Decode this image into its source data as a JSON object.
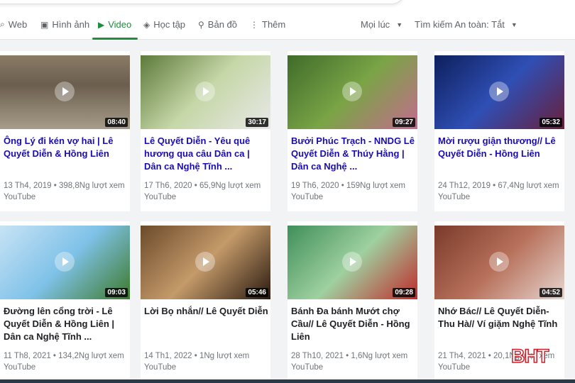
{
  "tabs": [
    {
      "label": "Web",
      "icon": "search-icon"
    },
    {
      "label": "Hình ảnh",
      "icon": "image-icon"
    },
    {
      "label": "Video",
      "icon": "video-icon",
      "active": true
    },
    {
      "label": "Học tập",
      "icon": "school-icon"
    },
    {
      "label": "Bản đồ",
      "icon": "map-pin-icon"
    },
    {
      "label": "Thêm",
      "icon": "more-icon"
    }
  ],
  "filters": {
    "time": "Mọi lúc",
    "safe_search": "Tìm kiếm An toàn: Tắt"
  },
  "videos": [
    {
      "title": "Ông Lý đi kén vợ hai | Lê Quyết Diễn & Hồng Liên",
      "duration": "08:40",
      "meta": "13 Th4, 2019 • 398,8Ng lượt xem",
      "source": "YouTube"
    },
    {
      "title": "Lê Quyết Diễn - Yêu quê hương qua câu Dân ca | Dân ca Nghệ Tĩnh ...",
      "duration": "30:17",
      "meta": "17 Th6, 2020 • 65,9Ng lượt xem",
      "source": "YouTube"
    },
    {
      "title": "Bưởi Phúc Trạch - NNDG Lê Quyết Diễn & Thúy Hằng | Dân ca Nghệ ...",
      "duration": "09:27",
      "meta": "19 Th6, 2020 • 159Ng lượt xem",
      "source": "YouTube"
    },
    {
      "title": "Mời rượu giận thương// Lê Quyết Diễn - Hồng Liên",
      "duration": "05:32",
      "meta": "24 Th12, 2019 • 67,4Ng lượt xem",
      "source": "YouTube"
    },
    {
      "title": "Đường lên cổng trời - Lê Quyết Diễn & Hồng Liên | Dân ca Nghệ Tĩnh ...",
      "duration": "09:03",
      "meta": "11 Th8, 2021 • 134,2Ng lượt xem",
      "source": "YouTube"
    },
    {
      "title": "Lời Bọ nhắn// Lê Quyết Diễn",
      "duration": "05:46",
      "meta": "14 Th1, 2022 • 1Ng lượt xem",
      "source": "YouTube"
    },
    {
      "title": "Bánh Đa bánh Mướt chợ Cầu// Lê Quyết Diễn - Hồng Liên",
      "duration": "09:28",
      "meta": "28 Th10, 2021 • 1,6Ng lượt xem",
      "source": "YouTube"
    },
    {
      "title": "Nhớ Bác// Lê Quyết Diễn- Thu Hà// Ví giặm Nghệ Tĩnh",
      "duration": "04:52",
      "meta": "21 Th4, 2021 • 20,1Ng lượt xem",
      "source": "YouTube"
    }
  ],
  "watermark": "BHT",
  "colors": {
    "accent": "#1e8e3e",
    "link": "#1a0dab"
  }
}
